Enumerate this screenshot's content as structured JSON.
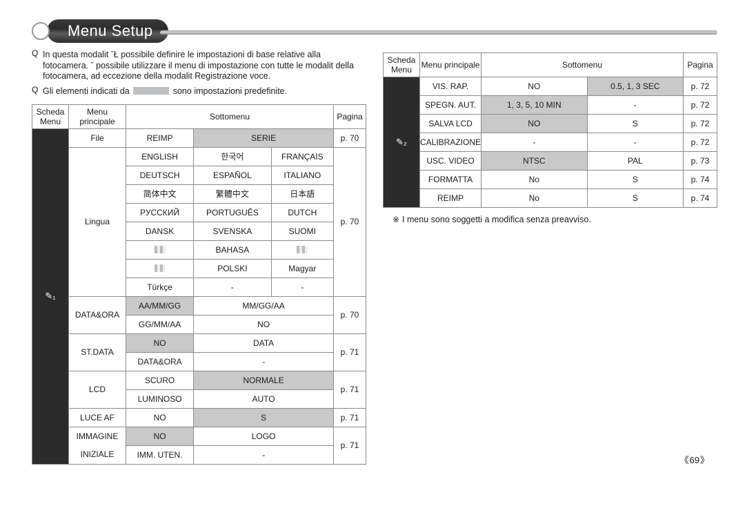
{
  "title": "Menu Setup",
  "intro": [
    "In questa modalit ˇŁ possibile definire le impostazioni di base relative alla fotocamera. ˇ possibile utilizzare il menu di impostazione con tutte le modalit della fotocamera, ad eccezione della modalit  Registrazione voce.",
    "Gli elementi indicati da",
    "sono impostazioni predefinite."
  ],
  "bullet": "Q",
  "hdr": {
    "schedamenu": "Scheda Menu",
    "menuprinc": "Menu principale",
    "sottomenu": "Sottomenu",
    "pagina": "Pagina"
  },
  "left": {
    "icon": "✎₁",
    "file": {
      "label": "File",
      "sub": [
        "REIMP",
        "SERIE"
      ],
      "page": "p. 70"
    },
    "lingua": {
      "label": "Lingua",
      "page": "p. 70",
      "rows": [
        [
          "ENGLISH",
          "한국어",
          "FRANÇAIS"
        ],
        [
          "DEUTSCH",
          "ESPAÑOL",
          "ITALIANO"
        ],
        [
          "简体中文",
          "繁體中文",
          "日本語"
        ],
        [
          "РУССКИЙ",
          "PORTUGUÊS",
          "DUTCH"
        ],
        [
          "DANSK",
          "SVENSKA",
          "SUOMI"
        ],
        [
          "",
          "BAHASA",
          ""
        ],
        [
          "",
          "POLSKI",
          "Magyar"
        ],
        [
          "Türkçe",
          "-",
          "-"
        ]
      ],
      "flagrows": [
        5,
        6
      ]
    },
    "dataora": {
      "label": "DATA&ORA",
      "rows": [
        [
          "AA/MM/GG",
          "MM/GG/AA"
        ],
        [
          "GG/MM/AA",
          "NO"
        ]
      ],
      "page": "p. 70"
    },
    "stdata": {
      "label": "ST.DATA",
      "rows": [
        [
          "NO",
          "DATA"
        ],
        [
          "DATA&ORA",
          "-"
        ]
      ],
      "page": "p. 71"
    },
    "lcd": {
      "label": "LCD",
      "rows": [
        [
          "SCURO",
          "NORMALE"
        ],
        [
          "LUMINOSO",
          "AUTO"
        ]
      ],
      "page": "p. 71"
    },
    "luceaf": {
      "label": "LUCE AF",
      "rows": [
        [
          "NO",
          "S"
        ]
      ],
      "page": "p. 71"
    },
    "imm": {
      "label1": "IMMAGINE",
      "label2": "INIZIALE",
      "rows": [
        [
          "NO",
          "LOGO"
        ],
        [
          "IMM. UTEN.",
          "-"
        ]
      ],
      "page": "p. 71"
    }
  },
  "right": {
    "icon": "✎₂",
    "rows": [
      {
        "m": "VIS. RAP.",
        "a": "NO",
        "b": "0.5, 1, 3 SEC",
        "p": "p. 72",
        "shadeB": true
      },
      {
        "m": "SPEGN. AUT.",
        "a": "1, 3, 5, 10 MIN",
        "b": "-",
        "p": "p. 72",
        "shadeA": true
      },
      {
        "m": "SALVA LCD",
        "a": "NO",
        "b": "S",
        "p": "p. 72",
        "shadeA": true
      },
      {
        "m": "CALIBRAZIONE",
        "a": "-",
        "b": "-",
        "p": "p. 72"
      },
      {
        "m": "USC. VIDEO",
        "a": "NTSC",
        "b": "PAL",
        "p": "p. 73",
        "shadeA": true
      },
      {
        "m": "FORMATTA",
        "a": "No",
        "b": "S",
        "p": "p. 74"
      },
      {
        "m": "REIMP",
        "a": "No",
        "b": "S",
        "p": "p. 74"
      }
    ],
    "footnote": "I menu sono soggetti a modifica senza preavviso."
  },
  "page_number": "69"
}
